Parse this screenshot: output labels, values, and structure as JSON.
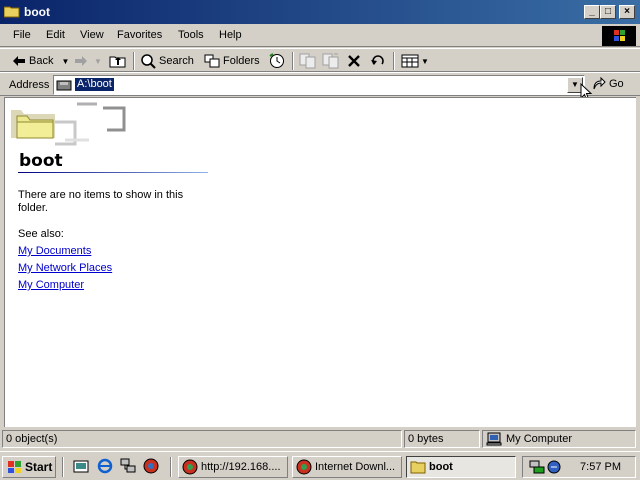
{
  "window": {
    "title": "boot"
  },
  "menu": [
    "File",
    "Edit",
    "View",
    "Favorites",
    "Tools",
    "Help"
  ],
  "toolbar": {
    "back_label": "Back",
    "search_label": "Search",
    "folders_label": "Folders"
  },
  "address": {
    "label": "Address",
    "value": "A:\\boot",
    "go_label": "Go"
  },
  "content": {
    "folder_name": "boot",
    "empty_message": "There are no items to show in this folder.",
    "see_also_label": "See also:",
    "links": [
      "My Documents",
      "My Network Places",
      "My Computer"
    ]
  },
  "status": {
    "objects": "0 object(s)",
    "size": "0 bytes",
    "location": "My Computer"
  },
  "taskbar": {
    "start_label": "Start",
    "tasks": [
      "http://192.168....",
      "Internet Downl...",
      "boot"
    ],
    "clock": "7:57 PM"
  },
  "colors": {
    "title_bar": "#0a246a",
    "face": "#d4d0c8",
    "link": "#0000cc",
    "selection": "#0a246a"
  }
}
